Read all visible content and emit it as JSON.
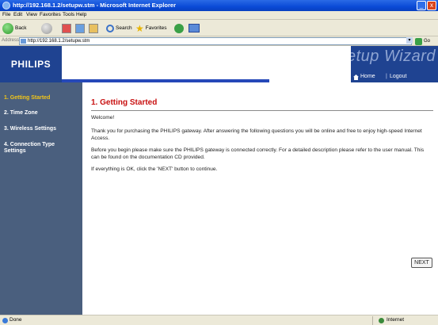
{
  "window": {
    "title": "http://192.168.1.2/setupw.stm - Microsoft Internet Explorer",
    "minimize": "_",
    "close": "x"
  },
  "menu": [
    "File",
    "Edit",
    "View",
    "Favorites",
    "Tools",
    "Help"
  ],
  "toolbar": {
    "back": "Back",
    "search": "Search",
    "favorites": "Favorites"
  },
  "address": {
    "label": "Address",
    "url": "http://192.168.1.2/setupw.stm",
    "go": "Go"
  },
  "page": {
    "logo": "PHILIPS",
    "wizard": "Setup Wizard",
    "home": "Home",
    "logout": "Logout",
    "sidebar": [
      {
        "label": "1. Getting Started",
        "active": true
      },
      {
        "label": "2. Time Zone",
        "active": false
      },
      {
        "label": "3. Wireless Settings",
        "active": false
      },
      {
        "label": "4. Connection Type Settings",
        "active": false
      }
    ],
    "heading": "1. Getting Started",
    "welcome": "Welcome!",
    "para1": "Thank you for purchasing the PHILIPS gateway. After answering the following questions you will be online and free to enjoy high-speed Internet Access.",
    "para2": "Before you begin please make sure the PHILIPS gateway is connected correctly. For a detailed description please refer to the user manual. This can be found on the documentation CD provided.",
    "para3": "If everything is OK, click the 'NEXT' button to continue.",
    "next": "NEXT"
  },
  "status": {
    "text": "Done",
    "zone": "Internet"
  },
  "colors": {
    "brand_blue": "#1f4391",
    "sidebar_bg": "#4a5f7e",
    "active_item": "#f0c419",
    "heading_red": "#c81010"
  }
}
